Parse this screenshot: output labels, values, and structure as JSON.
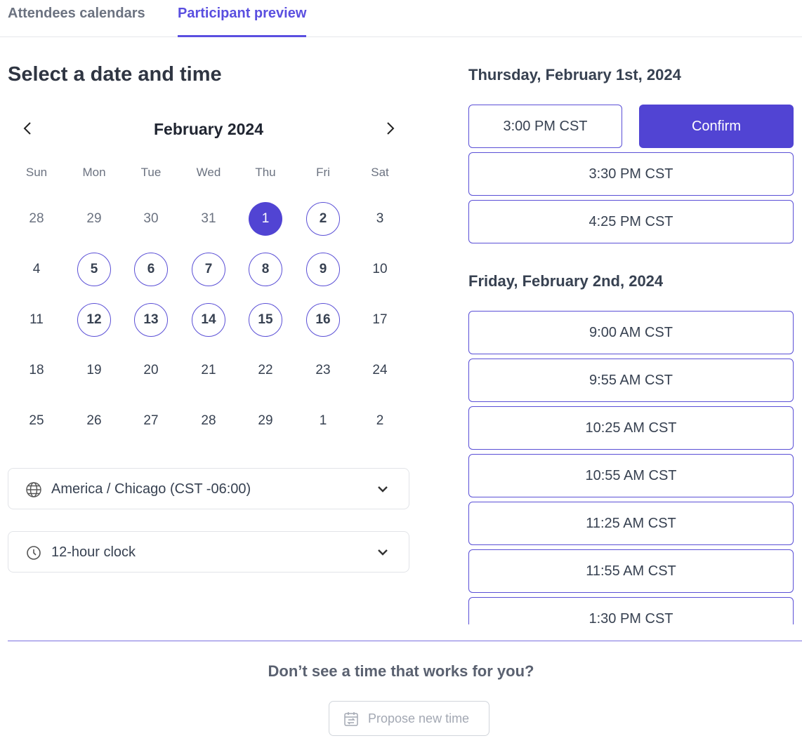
{
  "tabs": [
    {
      "label": "Attendees calendars",
      "active": false
    },
    {
      "label": "Participant preview",
      "active": true
    }
  ],
  "title": "Select a date and time",
  "calendar": {
    "month": "February 2024",
    "weekdays": [
      "Sun",
      "Mon",
      "Tue",
      "Wed",
      "Thu",
      "Fri",
      "Sat"
    ],
    "weeks": [
      [
        {
          "d": "28",
          "s": "other"
        },
        {
          "d": "29",
          "s": "other"
        },
        {
          "d": "30",
          "s": "other"
        },
        {
          "d": "31",
          "s": "other"
        },
        {
          "d": "1",
          "s": "sel"
        },
        {
          "d": "2",
          "s": "avail"
        },
        {
          "d": "3",
          "s": ""
        }
      ],
      [
        {
          "d": "4",
          "s": ""
        },
        {
          "d": "5",
          "s": "avail"
        },
        {
          "d": "6",
          "s": "avail"
        },
        {
          "d": "7",
          "s": "avail"
        },
        {
          "d": "8",
          "s": "avail"
        },
        {
          "d": "9",
          "s": "avail"
        },
        {
          "d": "10",
          "s": ""
        }
      ],
      [
        {
          "d": "11",
          "s": ""
        },
        {
          "d": "12",
          "s": "avail"
        },
        {
          "d": "13",
          "s": "avail"
        },
        {
          "d": "14",
          "s": "avail"
        },
        {
          "d": "15",
          "s": "avail"
        },
        {
          "d": "16",
          "s": "avail"
        },
        {
          "d": "17",
          "s": ""
        }
      ],
      [
        {
          "d": "18",
          "s": ""
        },
        {
          "d": "19",
          "s": ""
        },
        {
          "d": "20",
          "s": ""
        },
        {
          "d": "21",
          "s": ""
        },
        {
          "d": "22",
          "s": ""
        },
        {
          "d": "23",
          "s": ""
        },
        {
          "d": "24",
          "s": ""
        }
      ],
      [
        {
          "d": "25",
          "s": ""
        },
        {
          "d": "26",
          "s": ""
        },
        {
          "d": "27",
          "s": ""
        },
        {
          "d": "28",
          "s": ""
        },
        {
          "d": "29",
          "s": ""
        },
        {
          "d": "1",
          "s": ""
        },
        {
          "d": "2",
          "s": ""
        }
      ]
    ]
  },
  "timezone": "America / Chicago (CST -06:00)",
  "clock": "12-hour clock",
  "days": [
    {
      "heading": "Thursday, February 1st, 2024",
      "selected": "3:00 PM CST",
      "confirm": "Confirm",
      "slots": [
        "3:30 PM CST",
        "4:25 PM CST"
      ]
    },
    {
      "heading": "Friday, February 2nd, 2024",
      "slots": [
        "9:00 AM CST",
        "9:55 AM CST",
        "10:25 AM CST",
        "10:55 AM CST",
        "11:25 AM CST",
        "11:55 AM CST",
        "1:30 PM CST"
      ]
    }
  ],
  "footer": {
    "question": "Don’t see a time that works for you?",
    "propose": "Propose new time"
  },
  "colors": {
    "accent": "#5144d3",
    "tab_active": "#5a4fe0"
  }
}
